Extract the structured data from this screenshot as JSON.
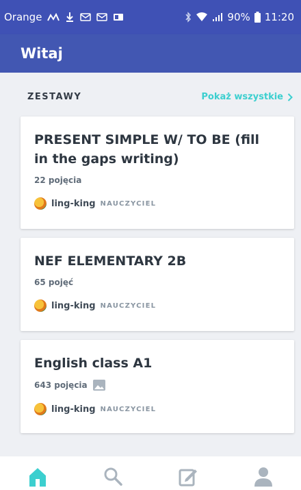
{
  "status_bar": {
    "carrier": "Orange",
    "battery": "90%",
    "time": "11:20"
  },
  "app_bar": {
    "title": "Witaj"
  },
  "section": {
    "title": "ZESTAWY",
    "link": "Pokaż wszystkie"
  },
  "cards": [
    {
      "title": "PRESENT SIMPLE W/ TO BE (fill in the gaps writing)",
      "terms": "22 pojęcia",
      "creator": "ling-king",
      "role": "NAUCZYCIEL"
    },
    {
      "title": "NEF ELEMENTARY 2B",
      "terms": "65 pojęć",
      "creator": "ling-king",
      "role": "NAUCZYCIEL"
    },
    {
      "title": "English class A1",
      "terms": "643 pojęcia",
      "creator": "ling-king",
      "role": "NAUCZYCIEL",
      "has_images": true
    }
  ],
  "nav": [
    "home-icon",
    "search-icon",
    "create-icon",
    "profile-icon"
  ],
  "colors": {
    "primary": "#3f51b5",
    "accent": "#3ccfcf",
    "nav_active": "#3ccfcf",
    "nav_inactive": "#aab4be"
  }
}
